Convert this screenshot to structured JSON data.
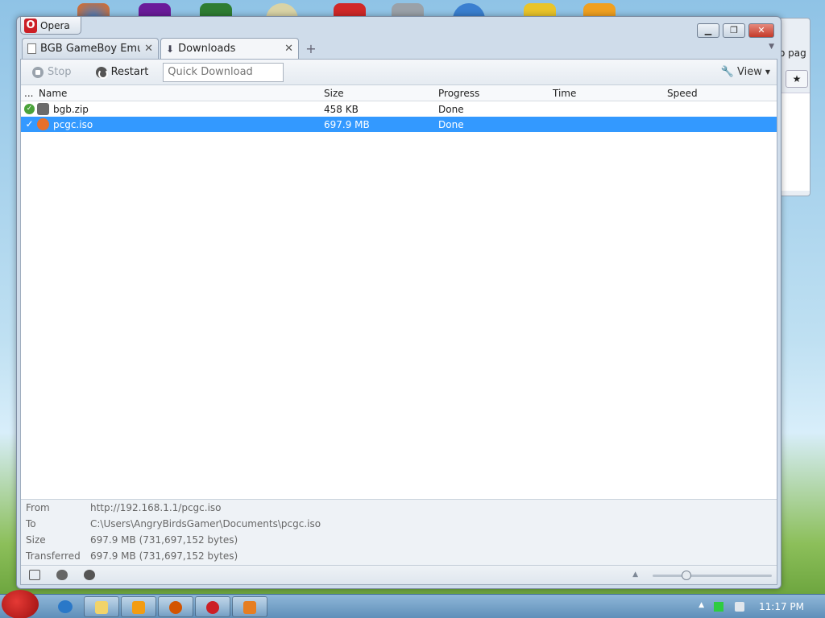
{
  "window": {
    "title": "Opera"
  },
  "tabs": [
    {
      "label": "BGB GameBoy Emul...",
      "active": false
    },
    {
      "label": "Downloads",
      "active": true
    }
  ],
  "toolbar": {
    "stop_label": "Stop",
    "restart_label": "Restart",
    "quick_download_placeholder": "Quick Download",
    "view_label": "View"
  },
  "table": {
    "columns": [
      "...",
      "Name",
      "Size",
      "Progress",
      "Time",
      "Speed"
    ],
    "rows": [
      {
        "name": "bgb.zip",
        "size": "458 KB",
        "progress": "Done",
        "time": "",
        "speed": "",
        "selected": false
      },
      {
        "name": "pcgc.iso",
        "size": "697.9 MB",
        "progress": "Done",
        "time": "",
        "speed": "",
        "selected": true
      }
    ]
  },
  "details": {
    "from_label": "From",
    "from_value": "http://192.168.1.1/pcgc.iso",
    "to_label": "To",
    "to_value": "C:\\Users\\AngryBirdsGamer\\Documents\\pcgc.iso",
    "size_label": "Size",
    "size_value": "697.9 MB (731,697,152 bytes)",
    "transferred_label": "Transferred",
    "transferred_value": "697.9 MB (731,697,152 bytes)"
  },
  "background_window": {
    "text": "o pag"
  },
  "taskbar": {
    "clock": "11:17 PM"
  },
  "colors": {
    "selection": "#3399ff",
    "close_button": "#c43a29",
    "opera_red": "#cc1f26"
  }
}
